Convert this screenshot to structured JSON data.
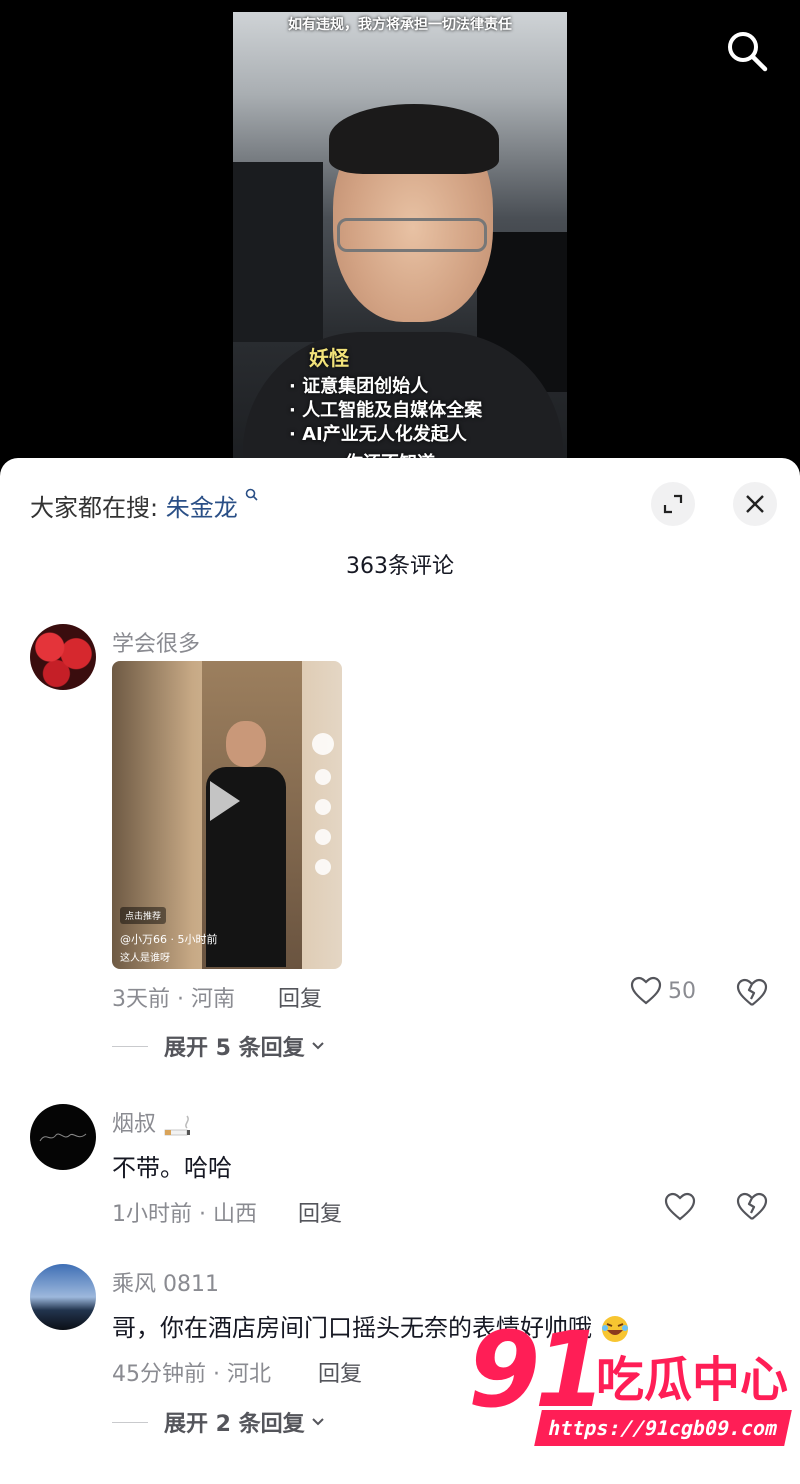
{
  "video": {
    "caption_top": "如有违规，我方将承担一切法律责任",
    "overlay_title": "妖怪",
    "overlay_lines": [
      "· 证意集团创始人",
      "· 人工智能及自媒体全案",
      "· AI产业无人化发起人"
    ],
    "overlay_partial": "你还不知道"
  },
  "panel": {
    "search_prefix": "大家都在搜:",
    "search_keyword": "朱金龙",
    "comment_count": "363条评论"
  },
  "comments": [
    {
      "username": "学会很多",
      "thumbnail": {
        "recommend_label": "点击推荐",
        "user": "@小万66 · 5小时前",
        "text": "这人是谁呀"
      },
      "time_location": "3天前 · 河南",
      "reply_label": "回复",
      "likes": "50",
      "expand_label": "展开 5 条回复"
    },
    {
      "username": "烟叔",
      "text": "不带。哈哈",
      "time_location": "1小时前 · 山西",
      "reply_label": "回复"
    },
    {
      "username": "乘风 0811",
      "text": "哥，你在酒店房间门口摇头无奈的表情好帅哦",
      "time_location": "45分钟前 · 河北",
      "reply_label": "回复",
      "expand_label": "展开 2 条回复"
    }
  ],
  "watermark": {
    "number": "91",
    "name": "吃瓜中心",
    "url": "https://91cgb09.com"
  },
  "colors": {
    "accent_keyword": "#2a4f86",
    "watermark_red": "#ff1e56",
    "secondary_text": "#8a8b91"
  }
}
